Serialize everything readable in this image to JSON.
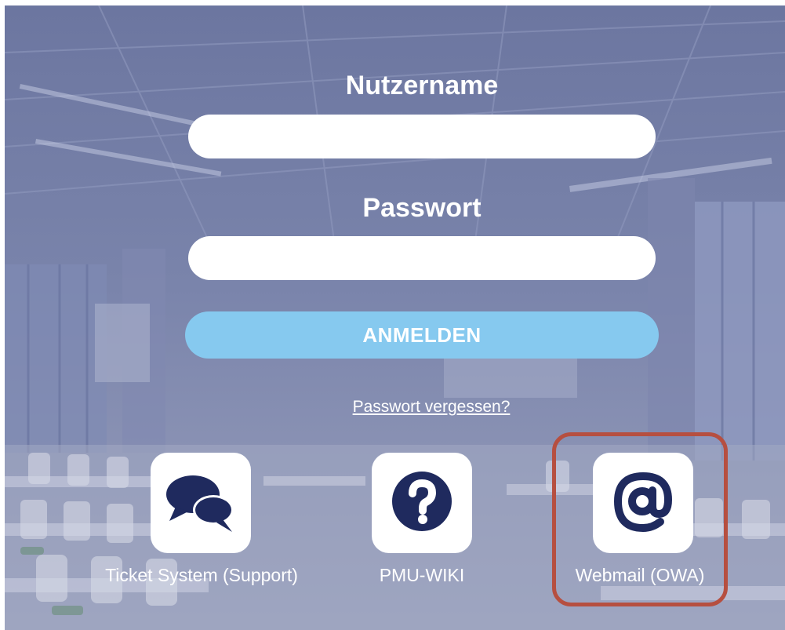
{
  "login": {
    "username_label": "Nutzername",
    "username_value": "",
    "password_label": "Passwort",
    "password_value": "",
    "submit_label": "ANMELDEN",
    "forgot_label": "Passwort vergessen?"
  },
  "tiles": [
    {
      "caption": "Ticket System (Support)",
      "icon": "chat-bubbles-icon"
    },
    {
      "caption": "PMU-WIKI",
      "icon": "question-circle-icon"
    },
    {
      "caption": "Webmail (OWA)",
      "icon": "at-sign-icon",
      "highlighted": true
    }
  ],
  "colors": {
    "overlay": "#5c6791",
    "button": "#86c9ef",
    "icon": "#1f2a5e",
    "highlight": "#b64f40"
  }
}
